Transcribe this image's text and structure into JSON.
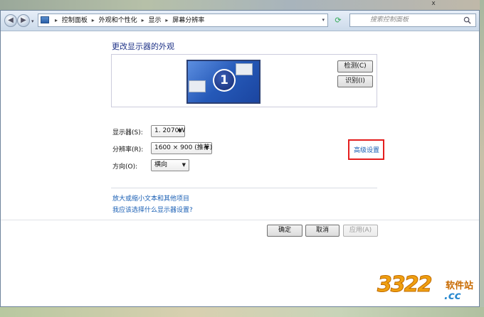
{
  "titlebar": {
    "close_glyph": "x"
  },
  "navigation": {
    "back_icon": "back-arrow-icon",
    "forward_icon": "forward-arrow-icon",
    "breadcrumbs": [
      "控制面板",
      "外观和个性化",
      "显示",
      "屏幕分辨率"
    ],
    "search_placeholder": "搜索控制面板"
  },
  "page": {
    "title": "更改显示器的外观",
    "monitor_number": "1",
    "detect_label": "检测(C)",
    "identify_label": "识别(I)"
  },
  "fields": {
    "display_label": "显示器(S):",
    "display_value": "1. 2070W",
    "resolution_label": "分辨率(R):",
    "resolution_value": "1600 × 900 (推荐)",
    "orientation_label": "方向(O):",
    "orientation_value": "横向"
  },
  "links": {
    "advanced": "高级设置",
    "text_size": "放大或缩小文本和其他项目",
    "which_settings": "我应该选择什么显示器设置?"
  },
  "actions": {
    "ok": "确定",
    "cancel": "取消",
    "apply": "应用(A)"
  },
  "watermark": {
    "number": "3322",
    "cn": "软件站",
    "domain": ".cc"
  },
  "colors": {
    "link": "#1a5fb4",
    "title": "#1e3287",
    "highlight_box": "#e41e1e"
  }
}
